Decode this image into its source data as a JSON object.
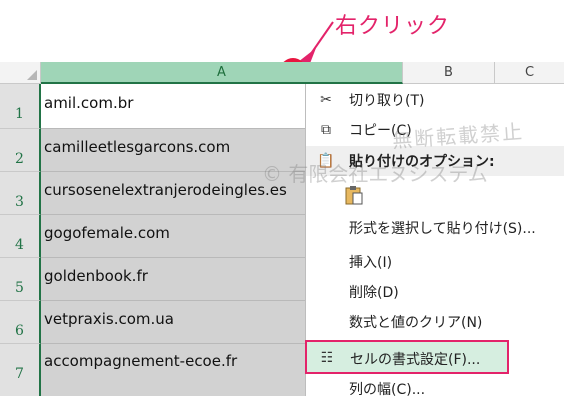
{
  "annotation": {
    "text": "右クリック",
    "color": "#e3236a"
  },
  "columns": [
    "A",
    "B",
    "C"
  ],
  "rows": [
    {
      "num": "1",
      "value": "amil.com.br"
    },
    {
      "num": "2",
      "value": "camilleetlesgarcons.com"
    },
    {
      "num": "3",
      "value": "cursosenelextranjerodeingles.es"
    },
    {
      "num": "4",
      "value": "gogofemale.com"
    },
    {
      "num": "5",
      "value": "goldenbook.fr"
    },
    {
      "num": "6",
      "value": "vetpraxis.com.ua"
    },
    {
      "num": "7",
      "value": "accompagnement-ecoe.fr"
    }
  ],
  "menu": {
    "cut": "切り取り(T)",
    "copy": "コピー(C)",
    "paste_header": "貼り付けのオプション:",
    "paste_special": "形式を選択して貼り付け(S)...",
    "insert": "挿入(I)",
    "delete": "削除(D)",
    "clear": "数式と値のクリア(N)",
    "format_cells": "セルの書式設定(F)...",
    "col_width": "列の幅(C)..."
  },
  "watermark": {
    "line1": "無断転載禁止",
    "line2": "© 有限会社エヌシステム"
  },
  "icons": [
    "scissors-icon",
    "copy-icon",
    "paste-icon",
    "clipboard-icon",
    "format-cells-icon"
  ]
}
